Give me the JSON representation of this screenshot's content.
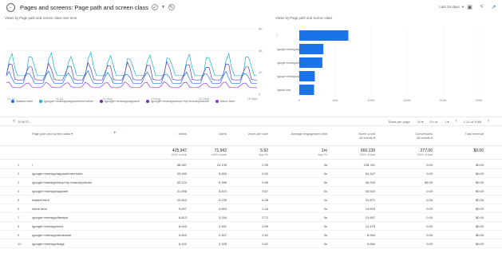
{
  "header": {
    "title": "Pages and screens: Page path and screen class",
    "daterange": "Last 28 days"
  },
  "charts": {
    "left_title": "Views by Page path and screen class over time",
    "right_title": "Views by Page path and screen class",
    "legend": [
      {
        "label": "/basket.html",
        "color": "#1a73e8"
      },
      {
        "label": "/google+redesign/apparel/men's/tee",
        "color": "#12b5cb"
      },
      {
        "label": "/google+redesign/apparel",
        "color": "#7627bb"
      },
      {
        "label": "/google+redesign/shop+by+brand/youtube",
        "color": "#673ab7"
      },
      {
        "label": "/store.html",
        "color": "#9334e6"
      }
    ]
  },
  "toolbar": {
    "search_placeholder": "Search...",
    "rows_per_page_label": "Rows per page:",
    "rows_per_page_value": "10",
    "goto_label": "Go to:",
    "goto_value": "1",
    "range": "1-10 of 1046"
  },
  "table": {
    "headers": {
      "dimension": "Page path and screen class",
      "views": "Views",
      "users": "Users",
      "views_per_user": "Views per user",
      "engagement": "Average engagement time",
      "event_count": "Event count",
      "event_count_sub": "All events",
      "conversions": "Conversions",
      "conversions_sub": "All events",
      "revenue": "Total revenue"
    },
    "totals": {
      "views": "425,347",
      "views_pct": "100% of total",
      "users": "71,942",
      "users_pct": "100% of total",
      "vpu": "5.92",
      "vpu_pct": "Avg 0%",
      "eng": "1m",
      "eng_pct": "Avg 0%",
      "events": "660,139",
      "events_pct": "100% of total",
      "conv": "277.00",
      "conv_pct": "100% of total",
      "rev": "$0.00"
    },
    "rows": [
      {
        "rank": "1",
        "path": "/",
        "views": "68,287",
        "users": "23,135",
        "vpu": "2.95",
        "eng": "0s",
        "events": "108,761",
        "conv": "0.00",
        "rev": "$0.00"
      },
      {
        "rank": "2",
        "path": "/google+redesign/apparel/men's/tee",
        "views": "33,459",
        "users": "5,653",
        "vpu": "5.92",
        "eng": "0s",
        "events": "51,247",
        "conv": "0.00",
        "rev": "$0.00"
      },
      {
        "rank": "3",
        "path": "/google+redesign/shop+by+brand/youtube",
        "views": "32,124",
        "users": "5,396",
        "vpu": "5.95",
        "eng": "0s",
        "events": "49,293",
        "conv": "65.00",
        "rev": "$0.00"
      },
      {
        "rank": "4",
        "path": "/google+redesign/apparel",
        "views": "21,598",
        "users": "5,874",
        "vpu": "3.67",
        "eng": "0s",
        "events": "33,519",
        "conv": "0.00",
        "rev": "$0.00"
      },
      {
        "rank": "5",
        "path": "/basket.html",
        "views": "20,642",
        "users": "3,235",
        "vpu": "6.38",
        "eng": "0s",
        "events": "31,871",
        "conv": "0.00",
        "rev": "$0.00"
      },
      {
        "rank": "6",
        "path": "/store.html",
        "views": "9,837",
        "users": "4,553",
        "vpu": "2.16",
        "eng": "0s",
        "events": "14,818",
        "conv": "0.00",
        "rev": "$0.00"
      },
      {
        "rank": "7",
        "path": "/google+redesign/lifestyle",
        "views": "8,813",
        "users": "3,244",
        "vpu": "2.72",
        "eng": "0s",
        "events": "13,697",
        "conv": "0.00",
        "rev": "$0.00"
      },
      {
        "rank": "8",
        "path": "/google+redesign/new",
        "views": "8,043",
        "users": "2,991",
        "vpu": "2.69",
        "eng": "0s",
        "events": "12,475",
        "conv": "0.00",
        "rev": "$0.00"
      },
      {
        "rank": "9",
        "path": "/google+redesign/drinkware",
        "views": "5,803",
        "users": "2,307",
        "vpu": "2.52",
        "eng": "0s",
        "events": "8,994",
        "conv": "0.00",
        "rev": "$0.00"
      },
      {
        "rank": "10",
        "path": "/google+redesign/bags",
        "views": "6,102",
        "users": "2,325",
        "vpu": "2.62",
        "eng": "0s",
        "events": "9,664",
        "conv": "0.00",
        "rev": "$0.00"
      }
    ]
  },
  "chart_data": [
    {
      "type": "line",
      "xlabel": "",
      "ylabel": "",
      "ylim": [
        0,
        6000
      ],
      "y_ticks": [
        "0",
        "2K",
        "4K",
        "6K"
      ],
      "x_ticks": [
        "01 Jul",
        "15 Jul",
        "01 Aug",
        "15 Aug",
        "01 Sept",
        "15 Sept"
      ],
      "series": [
        {
          "name": "/google+redesign/apparel/men's/tee",
          "color": "#12b5cb",
          "base": 1700,
          "amp": 1900
        },
        {
          "name": "/google+redesign/shop+by+brand/youtube",
          "color": "#673ab7",
          "base": 1300,
          "amp": 1500
        },
        {
          "name": "/google+redesign/apparel",
          "color": "#1a73e8",
          "base": 1000,
          "amp": 1000
        },
        {
          "name": "/basket.html",
          "color": "#9334e6",
          "base": 600,
          "amp": 500
        }
      ]
    },
    {
      "type": "bar",
      "categories": [
        "/",
        "/google+redesign/apparel/men's/tee",
        "/google+redesign/shop+by+brand/youtube",
        "/google+redesign/apparel",
        "/basket.html"
      ],
      "values": [
        68287,
        33459,
        32124,
        21598,
        20642
      ],
      "xlim": [
        0,
        250000
      ],
      "x_ticks": [
        "0",
        "50K",
        "100K",
        "150K",
        "200K",
        "250K"
      ],
      "color": "#1a73e8"
    }
  ]
}
